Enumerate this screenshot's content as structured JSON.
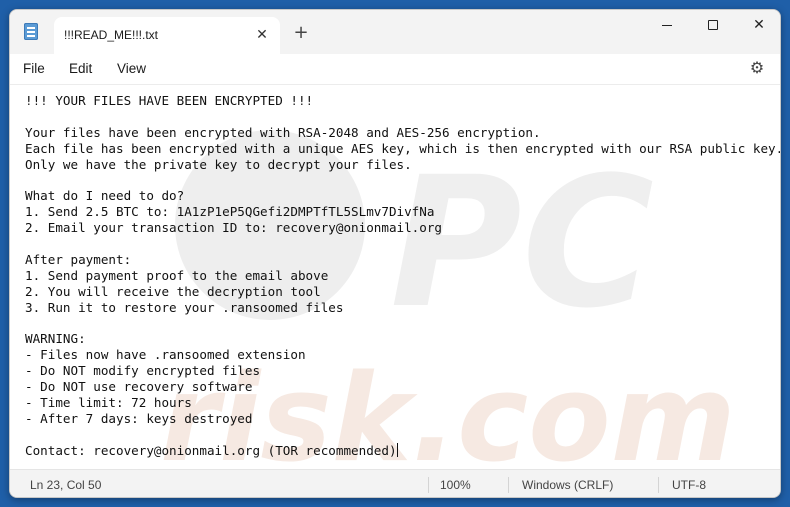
{
  "tab": {
    "title": "!!!READ_ME!!!.txt"
  },
  "menu": {
    "file": "File",
    "edit": "Edit",
    "view": "View"
  },
  "editor": {
    "lines": [
      "!!! YOUR FILES HAVE BEEN ENCRYPTED !!!",
      "",
      "Your files have been encrypted with RSA-2048 and AES-256 encryption.",
      "Each file has been encrypted with a unique AES key, which is then encrypted with our RSA public key.",
      "Only we have the private key to decrypt your files.",
      "",
      "What do I need to do?",
      "1. Send 2.5 BTC to: 1A1zP1eP5QGefi2DMPTfTL5SLmv7DivfNa",
      "2. Email your transaction ID to: recovery@onionmail.org",
      "",
      "After payment:",
      "1. Send payment proof to the email above",
      "2. You will receive the decryption tool",
      "3. Run it to restore your .ransoomed files",
      "",
      "WARNING:",
      "- Files now have .ransoomed extension",
      "- Do NOT modify encrypted files",
      "- Do NOT use recovery software",
      "- Time limit: 72 hours",
      "- After 7 days: keys destroyed",
      "",
      "Contact: recovery@onionmail.org (TOR recommended)"
    ]
  },
  "status": {
    "position": "Ln 23, Col 50",
    "zoom": "100%",
    "line_ending": "Windows (CRLF)",
    "encoding": "UTF-8"
  },
  "watermark": {
    "text": "pcrisk.com"
  },
  "icons": {
    "app": "notepad-icon",
    "close_tab": "close-icon",
    "new_tab": "plus-icon",
    "settings": "gear-icon"
  }
}
